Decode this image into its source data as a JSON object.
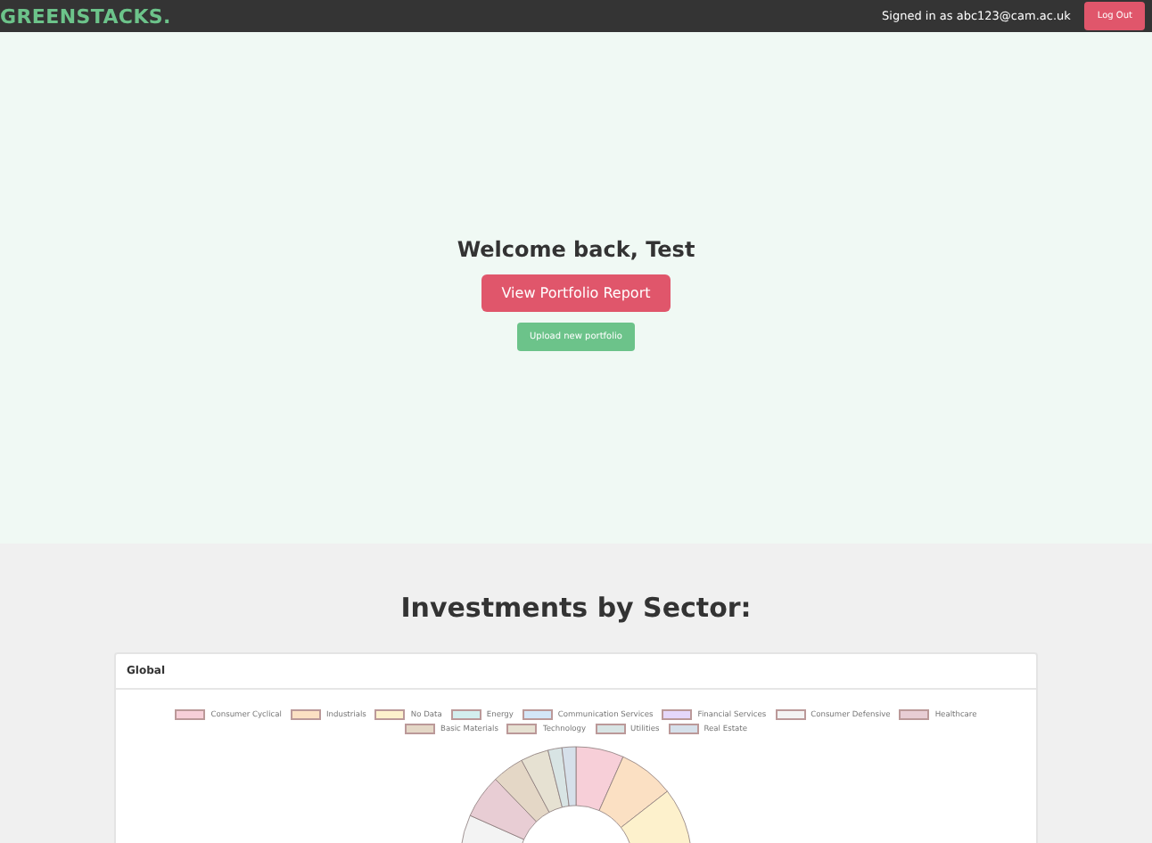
{
  "navbar": {
    "brand": "GREENSTACKS.",
    "signed_in": "Signed in as abc123@cam.ac.uk",
    "logout": "Log Out"
  },
  "hero": {
    "welcome": "Welcome back, Test",
    "report_button": "View Portfolio Report",
    "upload_button": "Upload new portfolio"
  },
  "sector_section": {
    "heading": "Investments by Sector:",
    "card_title": "Global",
    "legend": [
      {
        "label": "Consumer Cyclical",
        "color": "#f7cfd8"
      },
      {
        "label": "Industrials",
        "color": "#fbe0c3"
      },
      {
        "label": "No Data",
        "color": "#fdf1cc"
      },
      {
        "label": "Energy",
        "color": "#d3eeee"
      },
      {
        "label": "Communication Services",
        "color": "#d3e6f8"
      },
      {
        "label": "Financial Services",
        "color": "#e5d7fa"
      },
      {
        "label": "Consumer Defensive",
        "color": "#f3f3f3"
      },
      {
        "label": "Healthcare",
        "color": "#e8cdd4"
      },
      {
        "label": "Basic Materials",
        "color": "#e4d7c6"
      },
      {
        "label": "Technology",
        "color": "#e6e1d2"
      },
      {
        "label": "Utilities",
        "color": "#d8e4e4"
      },
      {
        "label": "Real Estate",
        "color": "#d6e0ea"
      }
    ]
  }
}
